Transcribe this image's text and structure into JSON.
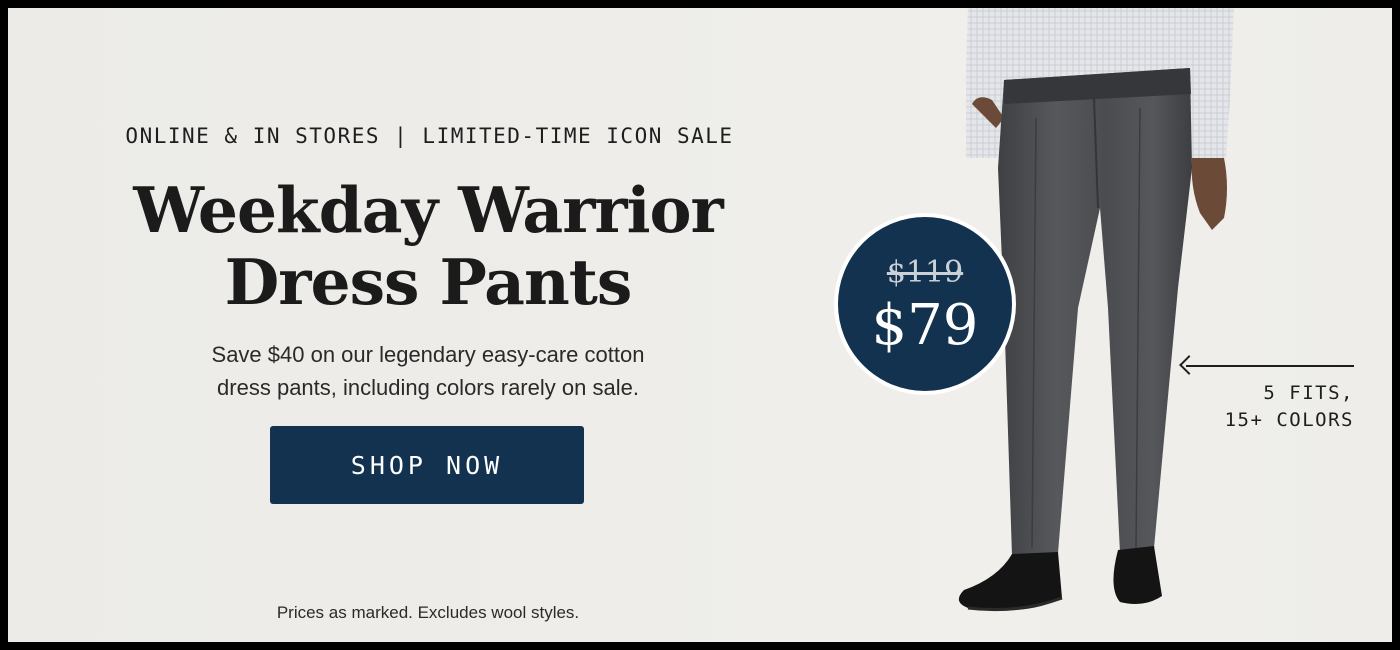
{
  "promo": {
    "eyebrow": "ONLINE & IN STORES | LIMITED-TIME ICON SALE",
    "headline_line1": "Weekday Warrior",
    "headline_line2": "Dress Pants",
    "subcopy_line1": "Save $40 on our legendary easy-care cotton",
    "subcopy_line2": "dress pants, including colors rarely on sale.",
    "cta_label": "SHOP NOW",
    "disclaimer": "Prices as marked. Excludes wool styles."
  },
  "price": {
    "original": "$119",
    "sale": "$79"
  },
  "callout": {
    "line1": "5 FITS,",
    "line2": "15+ COLORS",
    "icon": "arrow-left-icon"
  },
  "colors": {
    "navy": "#12324f",
    "background": "#eeede9",
    "pants": "#4a4c50"
  }
}
